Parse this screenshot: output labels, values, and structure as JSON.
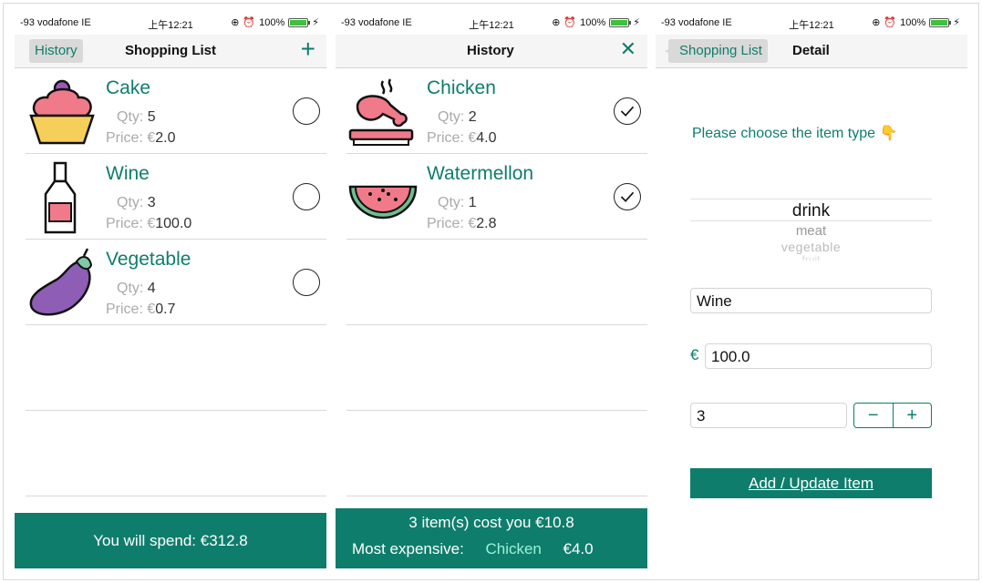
{
  "status_bar": {
    "carrier": "-93 vodafone IE",
    "time": "上午12:21",
    "battery": "100%",
    "battery_level": 1.0
  },
  "colors": {
    "accent": "#0e7d6c",
    "footer_bg": "#0e7d6c",
    "highlight": "#9ef0d6"
  },
  "shopping_list": {
    "nav": {
      "back_label": "History",
      "title": "Shopping List",
      "add_icon": "plus-icon"
    },
    "items": [
      {
        "name": "Cake",
        "qty_label": "Qty:",
        "qty": "5",
        "price_label": "Price: €",
        "price": "2.0",
        "icon": "cake-icon"
      },
      {
        "name": "Wine",
        "qty_label": "Qty:",
        "qty": "3",
        "price_label": "Price: €",
        "price": "100.0",
        "icon": "wine-bottle-icon"
      },
      {
        "name": "Vegetable",
        "qty_label": "Qty:",
        "qty": "4",
        "price_label": "Price: €",
        "price": "0.7",
        "icon": "eggplant-icon"
      }
    ],
    "footer": {
      "spend": "You will spend: €312.8"
    }
  },
  "history": {
    "nav": {
      "title": "History",
      "close_icon": "close-icon"
    },
    "items": [
      {
        "name": "Chicken",
        "qty_label": "Qty:",
        "qty": "2",
        "price_label": "Price: €",
        "price": "4.0",
        "icon": "chicken-icon"
      },
      {
        "name": "Watermellon",
        "qty_label": "Qty:",
        "qty": "1",
        "price_label": "Price: €",
        "price": "2.8",
        "icon": "watermelon-icon"
      }
    ],
    "footer": {
      "summary": "3  item(s) cost you €10.8",
      "most_expensive_label": "Most expensive:",
      "most_expensive_item": "Chicken",
      "most_expensive_price": "€4.0"
    }
  },
  "detail": {
    "nav": {
      "back_label": "Shopping List",
      "title": "Detail"
    },
    "prompt": "Please choose the item type 👇",
    "picker": {
      "selected": "drink",
      "options": [
        "meat",
        "vegetable",
        "fruit"
      ]
    },
    "name_value": "Wine",
    "currency": "€",
    "price_value": "100.0",
    "qty_value": "3",
    "stepper": {
      "minus": "−",
      "plus": "+"
    },
    "submit_label": "Add / Update Item"
  }
}
